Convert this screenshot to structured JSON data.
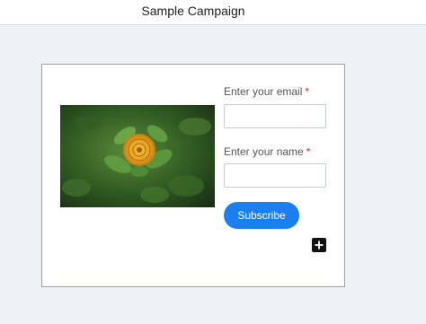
{
  "header": {
    "title": "Sample Campaign"
  },
  "form": {
    "email_label": "Enter your email",
    "name_label": "Enter your name",
    "required_marker": "*",
    "email_value": "",
    "name_value": "",
    "subscribe_label": "Subscribe",
    "image_icon": "rose-image",
    "add_icon": "plus-icon"
  },
  "colors": {
    "accent": "#1a7ff0",
    "required": "#e02020",
    "background": "#eef2f6"
  }
}
